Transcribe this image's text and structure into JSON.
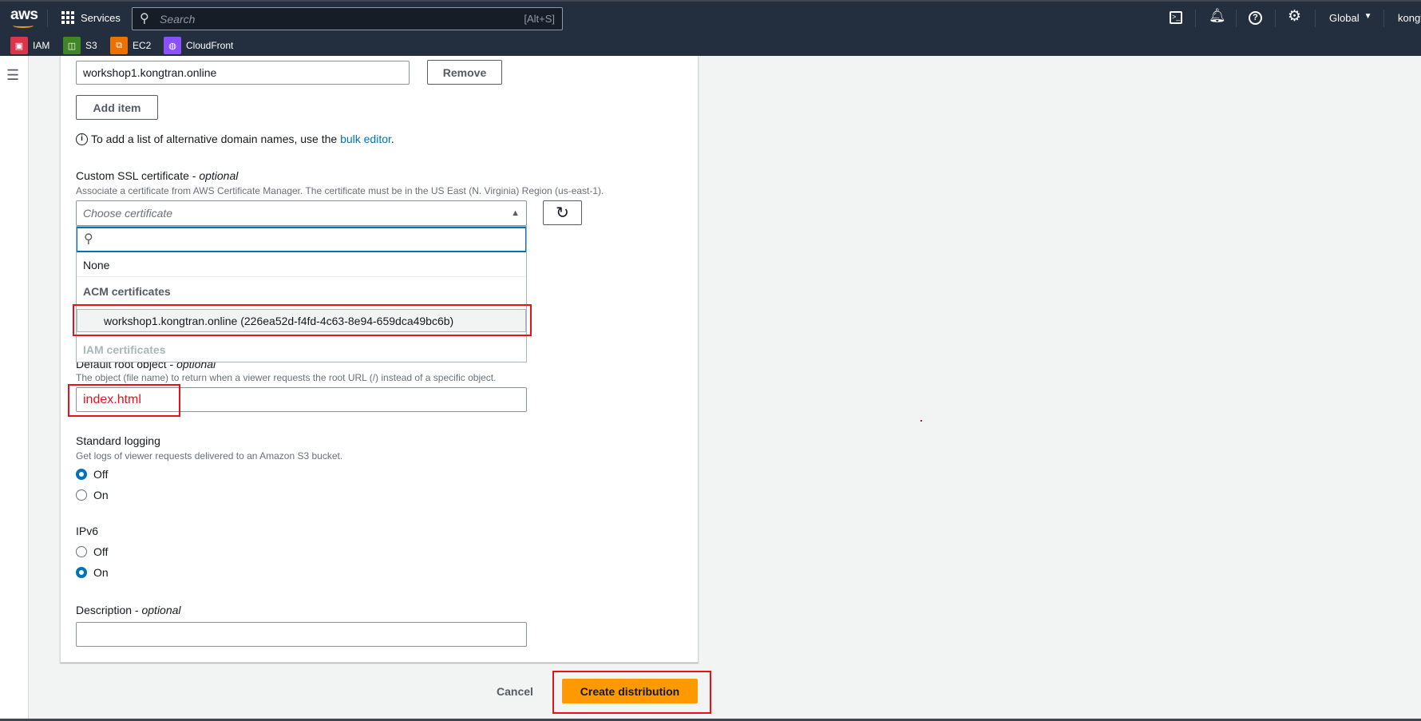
{
  "nav": {
    "logo": "aws",
    "services": "Services",
    "search_placeholder": "Search",
    "search_shortcut": "[Alt+S]",
    "region": "Global",
    "user": "kongt",
    "favorites": [
      {
        "label": "IAM",
        "color": "#dd344c"
      },
      {
        "label": "S3",
        "color": "#3f8624"
      },
      {
        "label": "EC2",
        "color": "#ed7100"
      },
      {
        "label": "CloudFront",
        "color": "#8c4fff"
      }
    ]
  },
  "form": {
    "alt_domain_value": "workshop1.kongtran.online",
    "remove": "Remove",
    "add_item": "Add item",
    "info_text": "To add a list of alternative domain names, use the ",
    "info_link": "bulk editor",
    "info_end": ".",
    "ssl_label": "Custom SSL certificate",
    "optional": "optional",
    "dash": " - ",
    "ssl_desc": "Associate a certificate from AWS Certificate Manager. The certificate must be in the US East (N. Virginia) Region (us-east-1).",
    "ssl_placeholder": "Choose certificate",
    "dropdown": {
      "none": "None",
      "acm_header": "ACM certificates",
      "acm_item": "workshop1.kongtran.online (226ea52d-f4fd-4c63-8e94-659dca49bc6b)",
      "iam_header": "IAM certificates"
    },
    "root_label": "Default root object",
    "root_desc": "The object (file name) to return when a viewer requests the root URL (/) instead of a specific object.",
    "root_value": "index.html",
    "logging_label": "Standard logging",
    "logging_desc": "Get logs of viewer requests delivered to an Amazon S3 bucket.",
    "logging_options": [
      "Off",
      "On"
    ],
    "logging_selected": "Off",
    "ipv6_label": "IPv6",
    "ipv6_options": [
      "Off",
      "On"
    ],
    "ipv6_selected": "On",
    "description_label": "Description",
    "description_value": ""
  },
  "footer": {
    "cancel": "Cancel",
    "create": "Create distribution"
  },
  "colors": {
    "nav": "#232f3e",
    "primary": "#ff9900",
    "link": "#0073bb",
    "highlight": "#e8111a"
  }
}
